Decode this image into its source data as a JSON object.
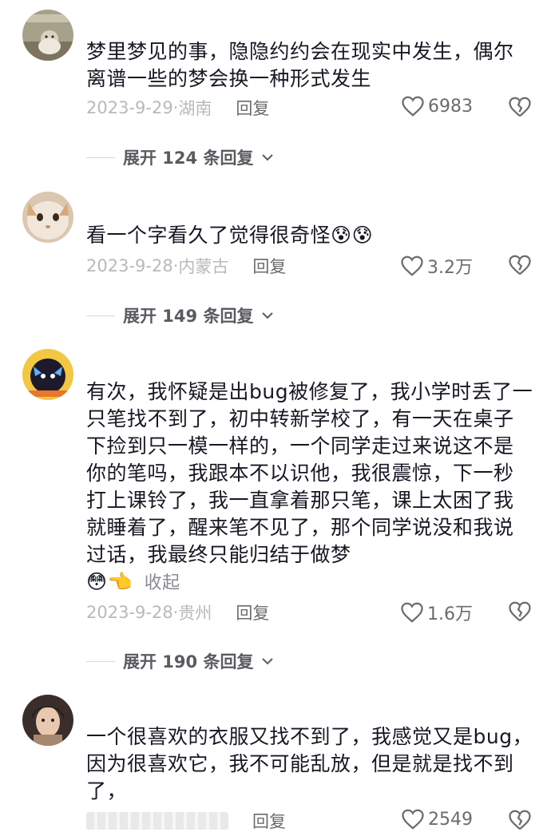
{
  "comments": [
    {
      "text": "梦里梦见的事，隐隐约约会在现实中发生，偶尔离谱一些的梦会换一种形式发生",
      "date": "2023-9-29",
      "location": "湖南",
      "reply_label": "回复",
      "likes": "6983",
      "expand_label": "展开 124 条回复"
    },
    {
      "text": "看一个字看久了觉得很奇怪",
      "emoji": [
        "😰",
        "😰"
      ],
      "date": "2023-9-28",
      "location": "内蒙古",
      "reply_label": "回复",
      "likes": "3.2万",
      "expand_label": "展开 149 条回复"
    },
    {
      "text": "有次，我怀疑是出bug被修复了，我小学时丢了一只笔找不到了，初中转新学校了，有一天在桌子下捡到只一模一样的，一个同学走过来说这不是你的笔吗，我跟本不以识他，我很震惊，下一秒打上课铃了，我一直拿着那只笔，课上太困了我就睡着了，醒来笔不见了，那个同学说没和我说过话，我最终只能归结于做梦",
      "emoji": [
        "😳",
        "👈"
      ],
      "collapse_label": "收起",
      "date": "2023-9-28",
      "location": "贵州",
      "reply_label": "回复",
      "likes": "1.6万",
      "expand_label": "展开 190 条回复"
    },
    {
      "text": "一个很喜欢的衣服又找不到了，我感觉又是bug，因为很喜欢它，我不可能乱放，但是就是找不到了，",
      "reply_label": "回复",
      "likes": "2549"
    }
  ],
  "colors": {
    "text": "#161823",
    "meta": "#b8b8bd",
    "secondary": "#6b6b70"
  },
  "icons": [
    "heart-icon",
    "broken-heart-icon",
    "chevron-down-icon"
  ]
}
